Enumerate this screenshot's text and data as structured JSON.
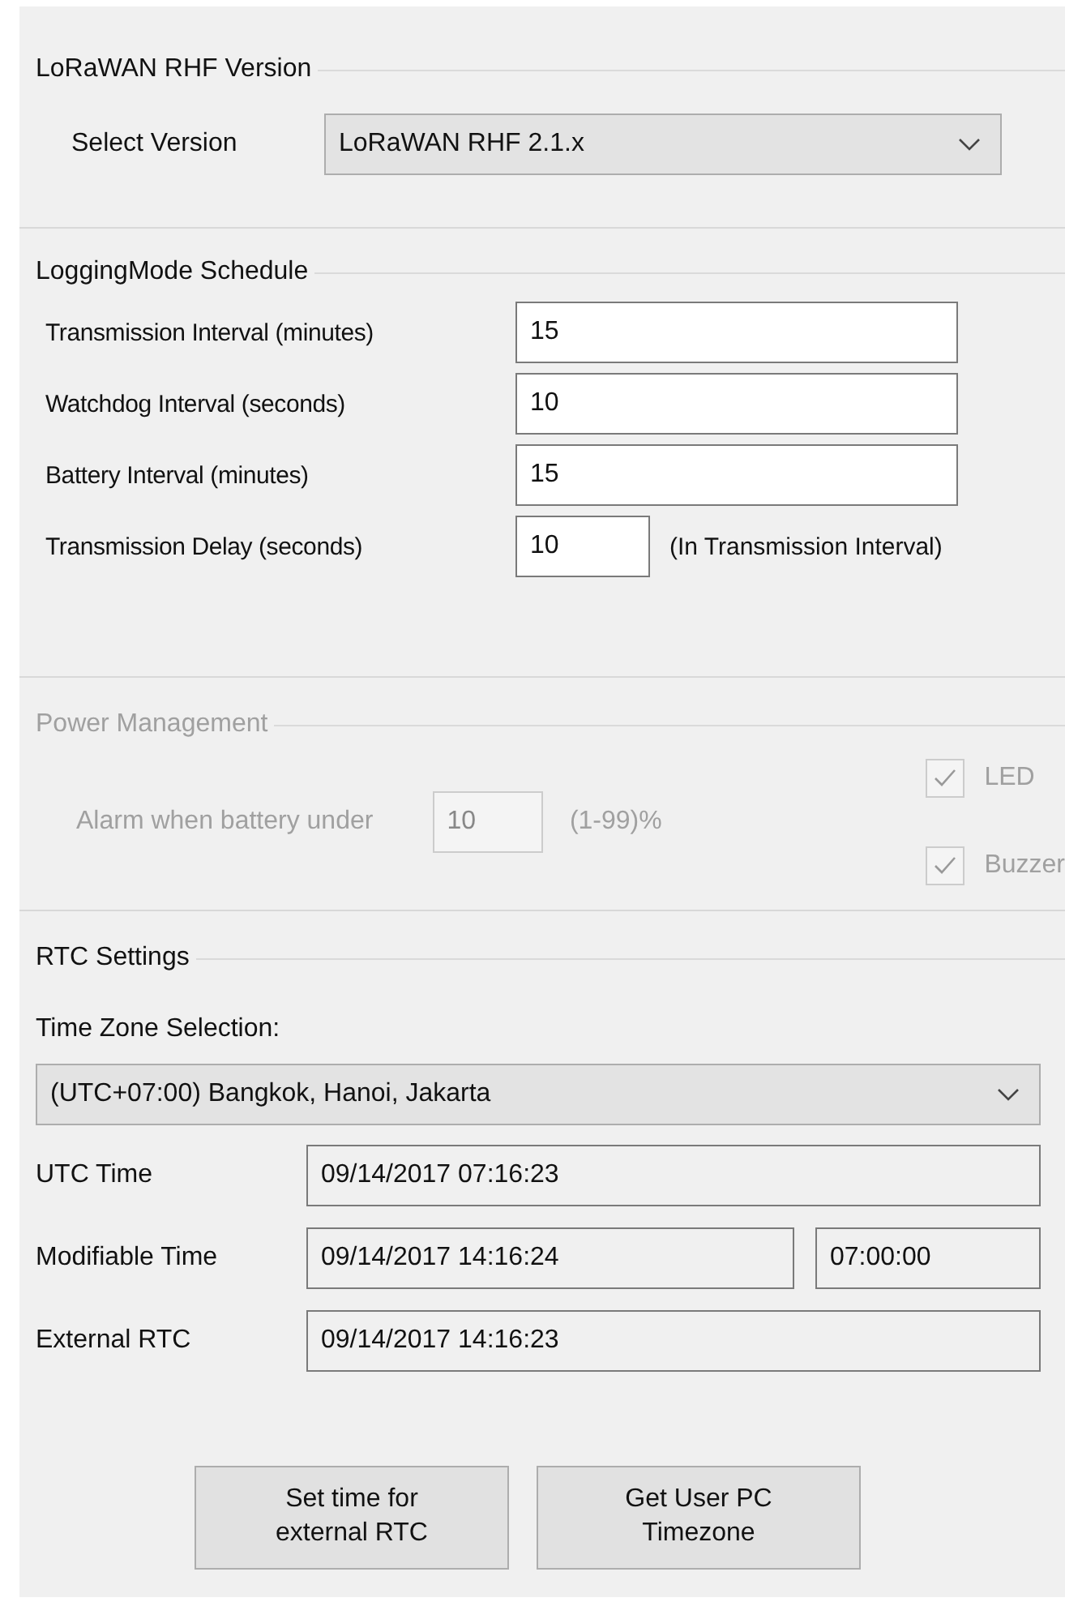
{
  "version_group": {
    "title": "LoRaWAN RHF Version",
    "label": "Select Version",
    "value": "LoRaWAN RHF 2.1.x"
  },
  "schedule": {
    "title": "LoggingMode Schedule",
    "fields": [
      {
        "kind": "wide",
        "label": "Transmission Interval (minutes)",
        "value": "15"
      },
      {
        "kind": "wide",
        "label": "Watchdog Interval (seconds)",
        "value": "10"
      },
      {
        "kind": "wide",
        "label": "Battery Interval (minutes)",
        "value": "15"
      },
      {
        "kind": "short",
        "label": "Transmission Delay (seconds)",
        "value": "10",
        "note": "(In Transmission Interval)"
      }
    ]
  },
  "power": {
    "title": "Power Management",
    "disabled": true,
    "label": "Alarm when battery under",
    "value": "10",
    "range": "(1-99)%",
    "options": [
      {
        "label": "LED",
        "checked": true
      },
      {
        "label": "Buzzer",
        "checked": true
      }
    ]
  },
  "rtc": {
    "title": "RTC Settings",
    "zone_label": "Time Zone Selection:",
    "zone": "(UTC+07:00) Bangkok, Hanoi, Jakarta",
    "rows": [
      {
        "label": "UTC Time",
        "value": "09/14/2017 07:16:23"
      },
      {
        "label": "Modifiable Time",
        "value": "09/14/2017 14:16:24",
        "offset": "07:00:00"
      },
      {
        "label": "External RTC",
        "value": "09/14/2017 14:16:23"
      }
    ]
  },
  "buttons": [
    {
      "lines": [
        "Set time for",
        "external RTC"
      ]
    },
    {
      "lines": [
        "Get User PC",
        "Timezone"
      ]
    }
  ]
}
